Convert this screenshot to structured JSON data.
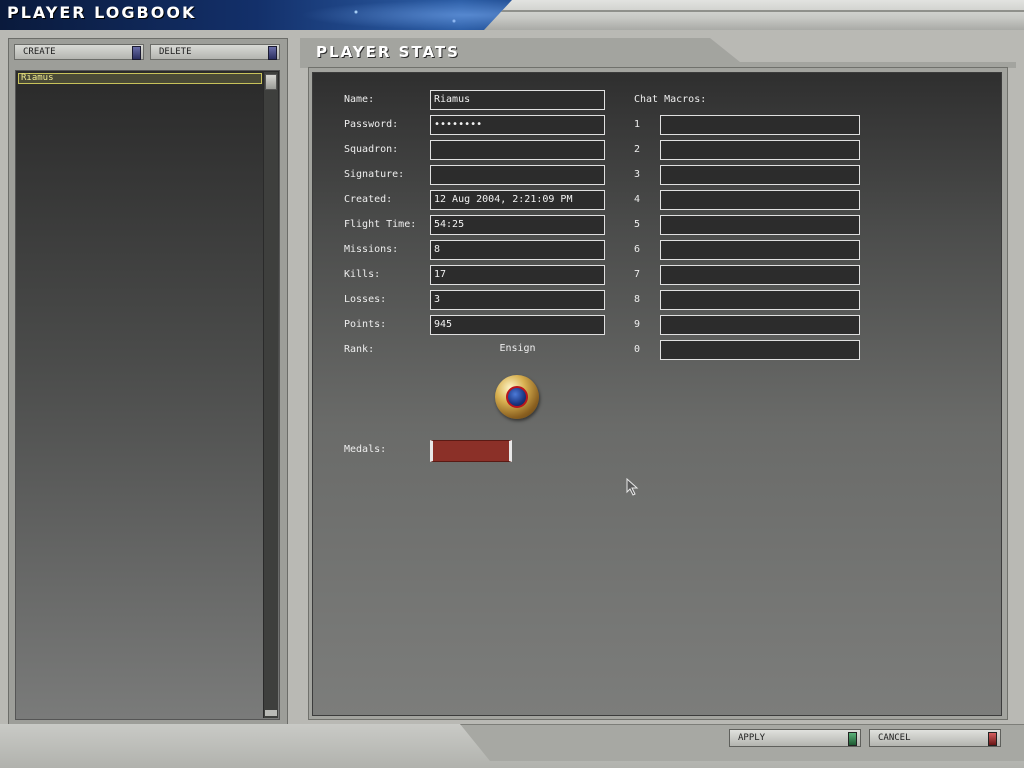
{
  "header": {
    "title": "PLAYER LOGBOOK"
  },
  "left_panel": {
    "create_label": "CREATE",
    "delete_label": "DELETE",
    "players": [
      "Riamus"
    ]
  },
  "stats": {
    "title": "PLAYER STATS",
    "labels": {
      "name": "Name:",
      "password": "Password:",
      "squadron": "Squadron:",
      "signature": "Signature:",
      "created": "Created:",
      "flight_time": "Flight Time:",
      "missions": "Missions:",
      "kills": "Kills:",
      "losses": "Losses:",
      "points": "Points:",
      "rank": "Rank:",
      "medals": "Medals:"
    },
    "values": {
      "name": "Riamus",
      "password": "••••••••",
      "squadron": "",
      "signature": "",
      "created": "12 Aug 2004,  2:21:09 PM",
      "flight_time": "54:25",
      "missions": "8",
      "kills": "17",
      "losses": "3",
      "points": "945",
      "rank": "Ensign"
    }
  },
  "chat_macros": {
    "label": "Chat Macros:",
    "numbers": [
      "1",
      "2",
      "3",
      "4",
      "5",
      "6",
      "7",
      "8",
      "9",
      "0"
    ],
    "values": [
      "",
      "",
      "",
      "",
      "",
      "",
      "",
      "",
      "",
      ""
    ]
  },
  "footer": {
    "apply_label": "APPLY",
    "cancel_label": "CANCEL"
  },
  "colors": {
    "apply_accent": "#2e7d4a",
    "cancel_accent": "#9a2020",
    "selection": "#c8c25a",
    "medal_ribbon": "#8b3028"
  },
  "icons": {
    "rank_insignia": "rank-insignia-icon",
    "cursor": "arrow-cursor-icon"
  }
}
